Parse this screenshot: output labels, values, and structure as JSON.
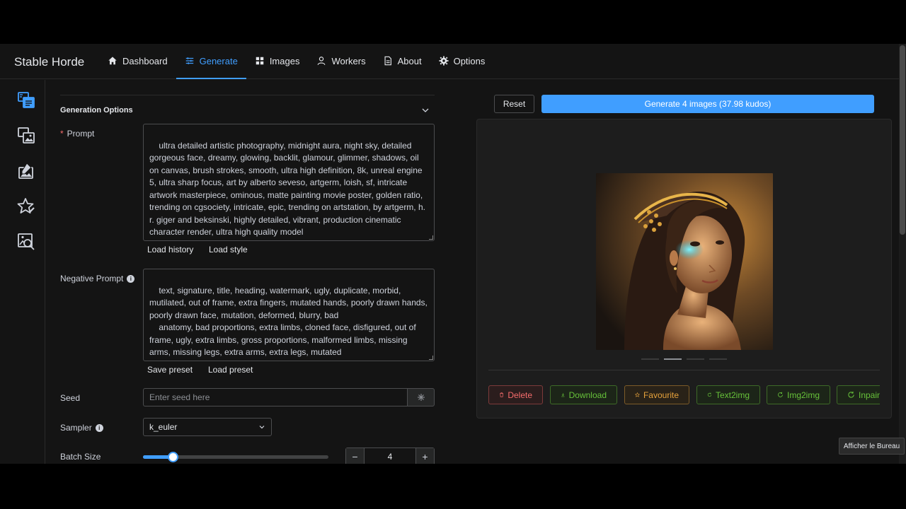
{
  "app": {
    "brand": "Stable Horde"
  },
  "nav": {
    "items": [
      {
        "label": "Dashboard",
        "icon": "home-icon"
      },
      {
        "label": "Generate",
        "icon": "sliders-icon",
        "active": true
      },
      {
        "label": "Images",
        "icon": "grid-icon"
      },
      {
        "label": "Workers",
        "icon": "user-icon"
      },
      {
        "label": "About",
        "icon": "document-icon"
      },
      {
        "label": "Options",
        "icon": "gear-icon"
      }
    ]
  },
  "sidebar": {
    "items": [
      {
        "icon": "text2img-icon",
        "active": true
      },
      {
        "icon": "img2img-icon"
      },
      {
        "icon": "inpaint-icon"
      },
      {
        "icon": "star-edit-icon"
      },
      {
        "icon": "interrogate-icon"
      }
    ]
  },
  "form": {
    "section_title": "Generation Options",
    "prompt_label": "Prompt",
    "prompt_required": "*",
    "prompt_value": "ultra detailed artistic photography, midnight aura, night sky, detailed gorgeous face, dreamy, glowing, backlit, glamour, glimmer, shadows, oil on canvas, brush strokes, smooth, ultra high definition, 8k, unreal engine 5, ultra sharp focus, art by alberto seveso, artgerm, loish, sf, intricate artwork masterpiece, ominous, matte painting movie poster, golden ratio, trending on cgsociety, intricate, epic, trending on artstation, by artgerm, h. r. giger and beksinski, highly detailed, vibrant, production cinematic character render, ultra high quality model",
    "load_history": "Load history",
    "load_style": "Load style",
    "negative_label": "Negative Prompt",
    "negative_value": "text, signature, title, heading, watermark, ugly, duplicate, morbid, mutilated, out of frame, extra fingers, mutated hands, poorly drawn hands, poorly drawn face, mutation, deformed, blurry, bad\n    anatomy, bad proportions, extra limbs, cloned face, disfigured, out of frame, ugly, extra limbs, gross proportions, malformed limbs, missing arms, missing legs, extra arms, extra legs, mutated\n    hands, fused fingers, too many fingers, long neck",
    "save_preset": "Save preset",
    "load_preset": "Load preset",
    "seed_label": "Seed",
    "seed_placeholder": "Enter seed here",
    "sampler_label": "Sampler",
    "sampler_value": "k_euler",
    "batch_label": "Batch Size",
    "batch_value": "4",
    "batch_slider_fraction": 0.16
  },
  "actions": {
    "reset": "Reset",
    "generate": "Generate 4 images (37.98 kudos)"
  },
  "preview": {
    "pager": {
      "count": 4,
      "active_index": 1
    },
    "buttons": [
      {
        "label": "Delete",
        "icon": "trash-icon",
        "variant": "danger"
      },
      {
        "label": "Download",
        "icon": "download-icon",
        "variant": "success"
      },
      {
        "label": "Favourite",
        "icon": "star-icon",
        "variant": "warning"
      },
      {
        "label": "Text2img",
        "icon": "refresh-icon",
        "variant": "success"
      },
      {
        "label": "Img2img",
        "icon": "refresh-icon",
        "variant": "success"
      },
      {
        "label": "Inpaint",
        "icon": "refresh-icon",
        "variant": "success"
      }
    ]
  },
  "tooltip": {
    "text": "Afficher le Bureau"
  },
  "colors": {
    "accent": "#409eff",
    "danger": "#f56c6c",
    "success": "#67c23a",
    "warning": "#e6a23c",
    "background": "#141414"
  }
}
